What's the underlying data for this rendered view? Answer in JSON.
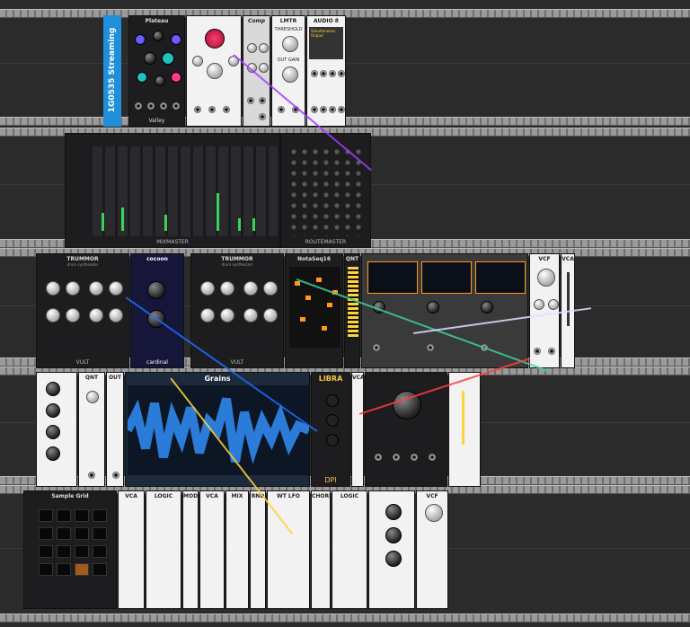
{
  "stream_label": "1G0535 Streaming",
  "modules": {
    "plateau": "Plateau",
    "plateau_brand": "Valley",
    "comp": "Comp",
    "limiter": "LMTR",
    "limiter_threshold": "THRESHOLD",
    "limiter_outgain": "OUT GAIN",
    "audio": "AUDIO 8",
    "audio_device": "Simultaneous Output",
    "mixer_brand": "MIXMASTER",
    "router_brand": "ROUTEMASTER",
    "trummor_a": "TRUMMOR",
    "trummor_a_sub": "drum synthesizer",
    "trummor_b": "TRUMMOR",
    "trummor_b_sub": "drum synthesizer",
    "vult": "VULT",
    "cocoon": "cocoon",
    "cardinal": "cardinal",
    "notaseq": "NotaSeq16",
    "quant": "QNT",
    "vcf_top": "VCF",
    "vca_top": "VCA",
    "grains": "Grains",
    "qnt2": "QNT",
    "out2": "OUT",
    "libra": "LIBRA",
    "dpi": "DPI",
    "vca_mid": "VCA",
    "sampler_grid": "Sample Grid",
    "vca_b1": "VCA",
    "mod_b": "MOD",
    "vca_b2": "VCA",
    "mix_b": "MIX",
    "rnd": "RND",
    "wt_lfo": "WT LFO",
    "chords": "CHORDS",
    "vcf_b": "VCF",
    "logic": "LOGIC"
  },
  "cable_colors": [
    "#a23cff",
    "#3dd19a",
    "#1f6bff",
    "#ff3d3d",
    "#ffd23d",
    "#e0e0ff"
  ]
}
